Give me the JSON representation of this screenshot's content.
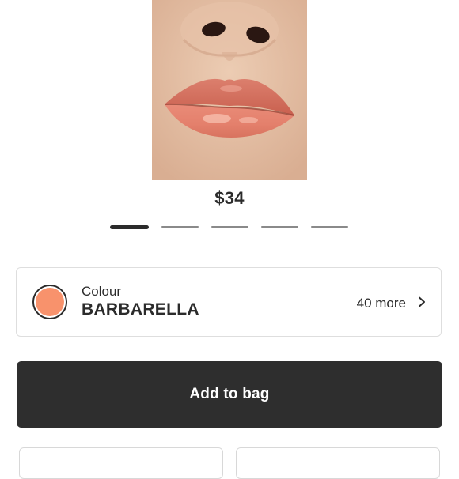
{
  "product": {
    "image_alt": "lips-swatch",
    "price": "$34"
  },
  "carousel": {
    "count": 5,
    "active_index": 0
  },
  "colour": {
    "label": "Colour",
    "name": "BARBARELLA",
    "more": "40 more",
    "swatch_color": "#f8926c",
    "icon": "chevron-right-icon"
  },
  "actions": {
    "add_to_bag": "Add to bag",
    "button_color": "#2e2e2e"
  }
}
